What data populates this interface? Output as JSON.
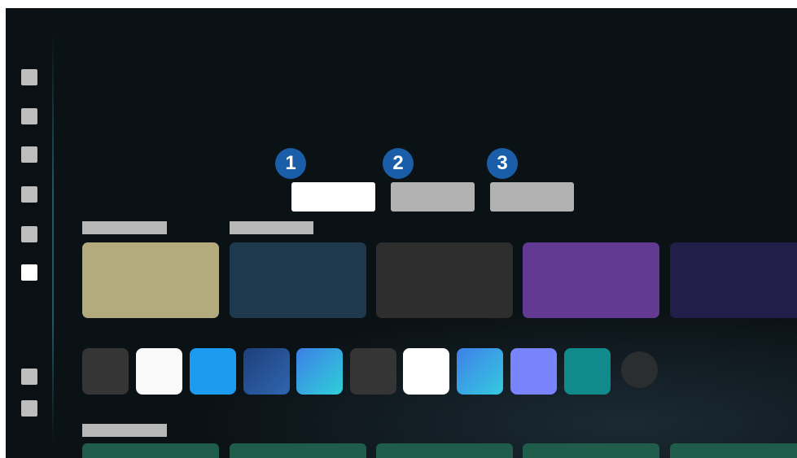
{
  "tabs": [
    {
      "badge": "1",
      "state": "selected"
    },
    {
      "badge": "2",
      "state": "unselected"
    },
    {
      "badge": "3",
      "state": "unselected"
    }
  ],
  "sidebar": {
    "items": [
      {
        "icon": "menu-item-icon"
      },
      {
        "icon": "menu-item-icon"
      },
      {
        "icon": "menu-item-icon"
      },
      {
        "icon": "menu-item-icon"
      },
      {
        "icon": "menu-item-icon"
      },
      {
        "icon": "menu-item-icon",
        "selected": true
      },
      {
        "icon": "menu-item-icon"
      },
      {
        "icon": "menu-item-icon"
      }
    ]
  },
  "colors": {
    "background": "#0b1216",
    "badge": "#1a5eaa",
    "tab_selected": "#ffffff",
    "tab_unselected": "#b2b2b2",
    "content_cards": [
      "#b3aa7e",
      "#1f394e",
      "#2e2e2e",
      "#623a93",
      "#211f4a"
    ],
    "app_tiles": [
      "#353535",
      "#f9f9f9",
      "#1c9bf0",
      "#28569a",
      "#36aee8",
      "#353535",
      "#ffffff",
      "#3d9ae8",
      "#7983fb",
      "#108a8a"
    ],
    "bottom_cards": "#1f5c49"
  }
}
